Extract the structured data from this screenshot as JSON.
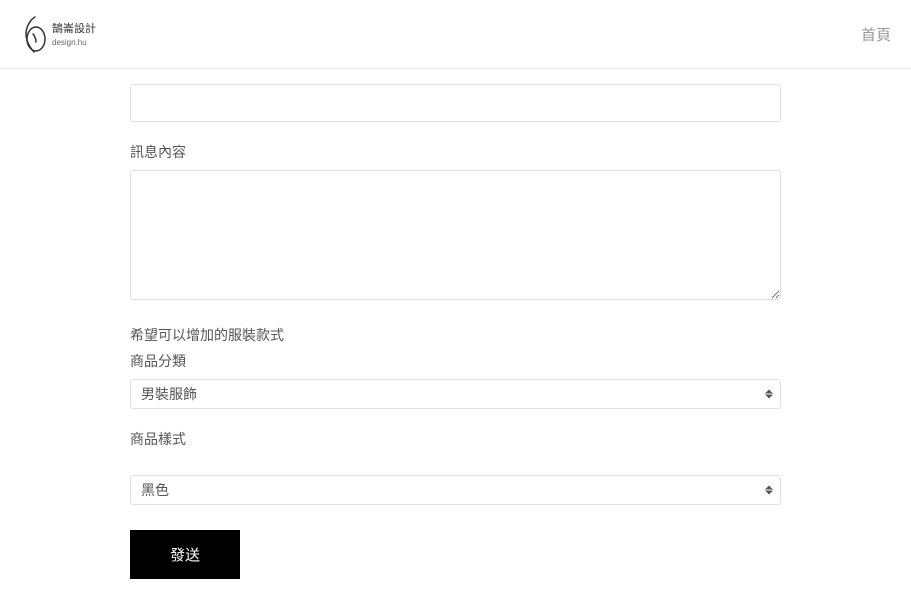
{
  "header": {
    "nav_home": "首頁"
  },
  "form": {
    "message_label": "訊息內容",
    "section_title": "希望可以增加的服裝款式",
    "category_label": "商品分類",
    "category_selected": "男裝服飾",
    "style_label": "商品樣式",
    "style_selected": "黑色",
    "submit_label": "發送"
  }
}
